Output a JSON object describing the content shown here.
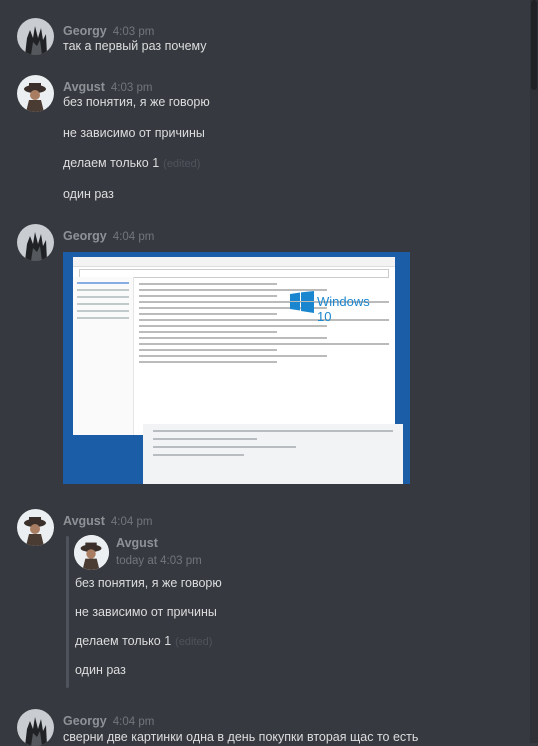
{
  "messages": [
    {
      "author": "Georgy",
      "time": "4:03 pm",
      "lines": [
        "так а первый раз почему"
      ]
    },
    {
      "author": "Avgust",
      "time": "4:03 pm",
      "lines": [
        "без понятия, я же говорю",
        "не зависимо от причины",
        "делаем только 1",
        "один раз"
      ],
      "edited": "(edited)"
    },
    {
      "author": "Georgy",
      "time": "4:04 pm",
      "attachment": {
        "brand_text": "Windows 10"
      }
    },
    {
      "author": "Avgust",
      "time": "4:04 pm",
      "quote": {
        "author": "Avgust",
        "time": "today at 4:03 pm",
        "lines": [
          "без понятия, я же говорю",
          "не зависимо от причины",
          "делаем только 1",
          "один раз"
        ],
        "edited": "(edited)"
      }
    },
    {
      "author": "Georgy",
      "time": "4:04 pm",
      "lines": [
        "сверни две картинки одна в день покупки вторая щас то есть"
      ]
    }
  ],
  "colors": {
    "background": "#36393f",
    "text": "#dcddde",
    "username": "#8e9297",
    "timestamp": "#72767d"
  }
}
